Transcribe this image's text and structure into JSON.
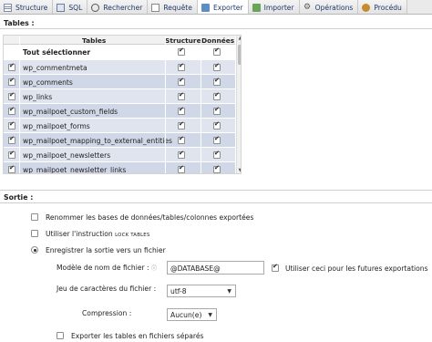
{
  "tabs": [
    {
      "label": "Structure",
      "icon": "table-structure-icon",
      "active": false
    },
    {
      "label": "SQL",
      "icon": "sql-icon",
      "active": false
    },
    {
      "label": "Rechercher",
      "icon": "search-icon",
      "active": false
    },
    {
      "label": "Requête",
      "icon": "query-icon",
      "active": false
    },
    {
      "label": "Exporter",
      "icon": "export-icon",
      "active": true
    },
    {
      "label": "Importer",
      "icon": "import-icon",
      "active": false
    },
    {
      "label": "Opérations",
      "icon": "operations-icon",
      "active": false
    },
    {
      "label": "Procédu",
      "icon": "procedures-icon",
      "active": false
    }
  ],
  "tables_section": {
    "heading": "Tables :",
    "columns": {
      "tables": "Tables",
      "structure": "Structure",
      "data": "Données"
    },
    "select_all": "Tout sélectionner",
    "rows": [
      {
        "name": "wp_commentmeta",
        "selected": true,
        "structure": true,
        "data": true
      },
      {
        "name": "wp_comments",
        "selected": true,
        "structure": true,
        "data": true
      },
      {
        "name": "wp_links",
        "selected": true,
        "structure": true,
        "data": true
      },
      {
        "name": "wp_mailpoet_custom_fields",
        "selected": true,
        "structure": true,
        "data": true
      },
      {
        "name": "wp_mailpoet_forms",
        "selected": true,
        "structure": true,
        "data": true
      },
      {
        "name": "wp_mailpoet_mapping_to_external_entities",
        "selected": true,
        "structure": true,
        "data": true
      },
      {
        "name": "wp_mailpoet_newsletters",
        "selected": true,
        "structure": true,
        "data": true
      },
      {
        "name": "wp_mailpoet_newsletter_links",
        "selected": true,
        "structure": true,
        "data": true
      }
    ]
  },
  "output_section": {
    "heading": "Sortie :",
    "rename_label": "Renommer les bases de données/tables/colonnes exportées",
    "lock_label_pre": "Utiliser l'instruction",
    "lock_label_code": "LOCK TABLES",
    "save_label": "Enregistrer la sortie vers un fichier",
    "filename_label": "Modèle de nom de fichier :",
    "filename_hint": "ⓘ",
    "filename_value": "@DATABASE@",
    "future_label": "Utiliser ceci pour les futures exportations",
    "charset_label": "Jeu de caractères du fichier :",
    "charset_value": "utf-8",
    "compression_label": "Compression :",
    "compression_value": "Aucun(e)",
    "separate_label": "Exporter les tables en fichiers séparés"
  }
}
